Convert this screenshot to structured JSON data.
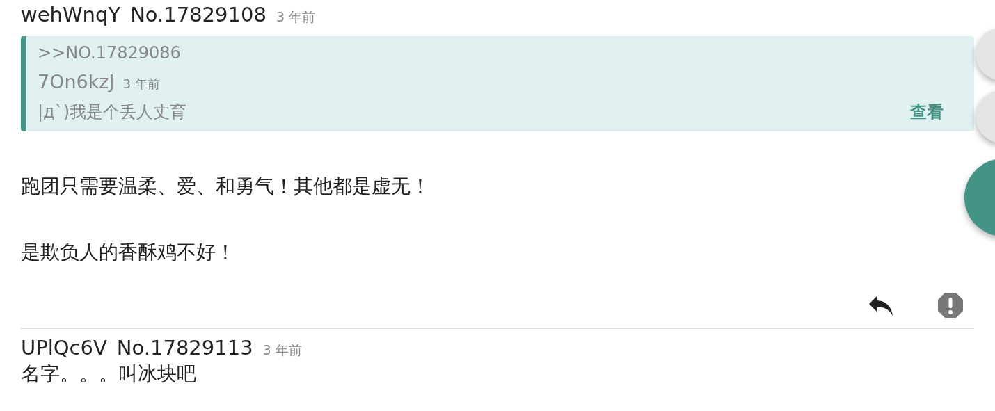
{
  "posts": [
    {
      "user": "wehWnqY",
      "number": "No.17829108",
      "time": "3 年前",
      "quote": {
        "ref": ">>NO.17829086",
        "user": "7On6kzJ",
        "time": "3 年前",
        "text": "|д`)我是个丢人丈育",
        "view": "查看"
      },
      "paragraphs": [
        "跑团只需要温柔、爱、和勇气！其他都是虚无！",
        "是欺负人的香酥鸡不好！"
      ],
      "actions": true
    },
    {
      "user": "UPlQc6V",
      "number": "No.17829113",
      "time": "3 年前",
      "paragraphs": [
        "名字。。。叫冰块吧"
      ],
      "actions": false
    }
  ]
}
